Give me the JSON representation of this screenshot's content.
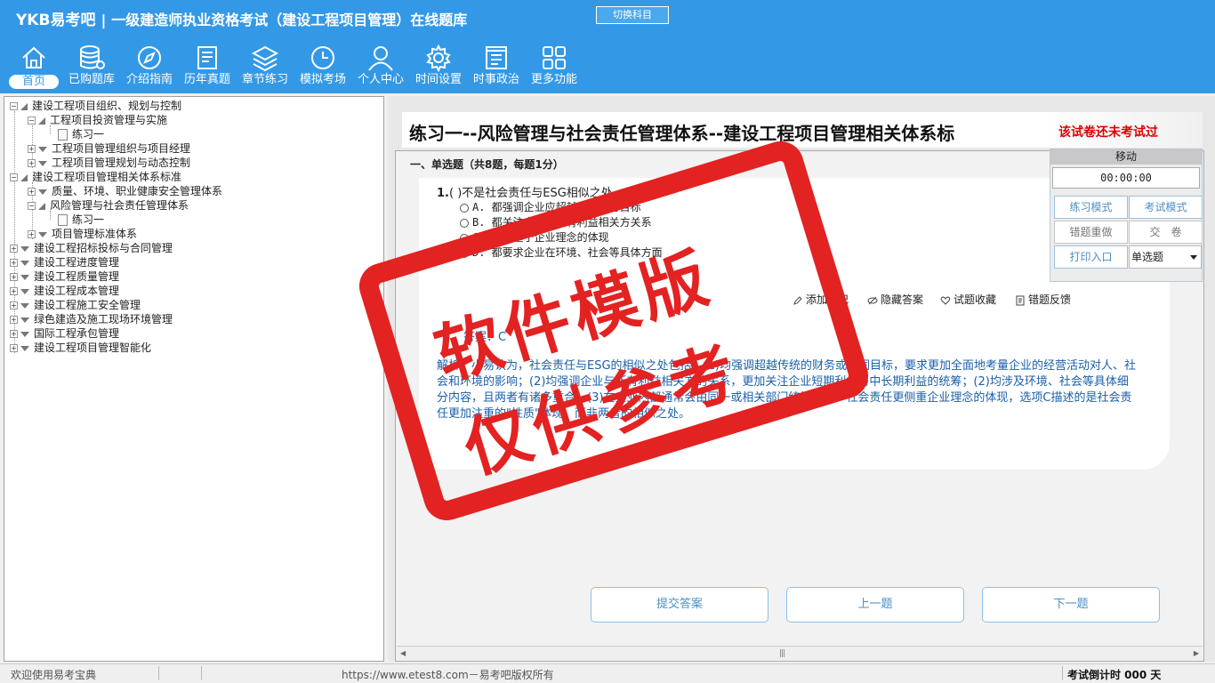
{
  "header": {
    "brand": "YKB易考吧",
    "title": "一级建造师执业资格考试（建设工程项目管理）在线题库",
    "switch_label": "切换科目",
    "nav": [
      {
        "label": "首页",
        "icon": "home-icon"
      },
      {
        "label": "已购题库",
        "icon": "database-icon"
      },
      {
        "label": "介绍指南",
        "icon": "compass-icon"
      },
      {
        "label": "历年真题",
        "icon": "document-list-icon"
      },
      {
        "label": "章节练习",
        "icon": "layers-icon"
      },
      {
        "label": "模拟考场",
        "icon": "clock-icon"
      },
      {
        "label": "个人中心",
        "icon": "user-icon"
      },
      {
        "label": "时间设置",
        "icon": "gear-icon"
      },
      {
        "label": "时事政治",
        "icon": "news-icon"
      },
      {
        "label": "更多功能",
        "icon": "grid-icon"
      }
    ]
  },
  "tree": [
    {
      "label": "建设工程项目组织、规划与控制"
    },
    {
      "label": "工程项目投资管理与实施"
    },
    {
      "label": "练习一"
    },
    {
      "label": "工程项目管理组织与项目经理"
    },
    {
      "label": "工程项目管理规划与动态控制"
    },
    {
      "label": "建设工程项目管理相关体系标准"
    },
    {
      "label": "质量、环境、职业健康安全管理体系"
    },
    {
      "label": "风险管理与社会责任管理体系"
    },
    {
      "label": "练习一"
    },
    {
      "label": "项目管理标准体系"
    },
    {
      "label": "建设工程招标投标与合同管理"
    },
    {
      "label": "建设工程进度管理"
    },
    {
      "label": "建设工程质量管理"
    },
    {
      "label": "建设工程成本管理"
    },
    {
      "label": "建设工程施工安全管理"
    },
    {
      "label": "绿色建造及施工现场环境管理"
    },
    {
      "label": "国际工程承包管理"
    },
    {
      "label": "建设工程项目管理智能化"
    }
  ],
  "main": {
    "exercise_title": "练习一--风险管理与社会责任管理体系--建设工程项目管理相关体系标",
    "exam_status": "该试卷还未考试过",
    "section_header": "一、单选题（共8题，每题1分）",
    "question": {
      "number": "1.",
      "stem": "( )不是社会责任与ESG相似之处。",
      "options": [
        "A. 都强调企业应超越传统财务目标",
        "B. 都关注企业与所有利益相关方关系",
        "C. 都侧重于企业理念的体现",
        "D. 都要求企业在环境、社会等具体方面"
      ]
    },
    "tools": {
      "add_note": "添加笔记",
      "hide_answer": "隐藏答案",
      "favorite": "试题收藏",
      "report_error": "错题反馈"
    },
    "answer_line": "答案：C",
    "analysis": "解析：小易认为，社会责任与ESG的相似之处包括：(1)均强调超越传统的财务或利润目标，要求更加全面地考量企业的经营活动对人、社会和环境的影响；(2)均强调企业与所有利益相关方的关系，更加关注企业短期利益与中长期利益的统筹；(2)均涉及环境、社会等具体细分内容，且两者有诸多重合。(3)在企业内部通常会由同一或相关部门统筹落实。社会责任更侧重企业理念的体现，选项C描述的是社会责任更加注重的\"性质\"体现，而非两者的相似之处。",
    "buttons": {
      "submit": "提交答案",
      "prev": "上一题",
      "next": "下一题"
    }
  },
  "control_panel": {
    "move_label": "移动",
    "timer": "00:00:00",
    "practice_mode": "练习模式",
    "exam_mode": "考试模式",
    "redo_wrong": "错题重做",
    "submit_paper": "交　卷",
    "print": "打印入口",
    "question_type": "单选题"
  },
  "status_bar": {
    "welcome": "欢迎使用易考宝典",
    "copyright": "https://www.etest8.com－易考吧版权所有",
    "countdown": "考试倒计时 000 天"
  },
  "watermark": {
    "line1": "软件模版",
    "line2": "仅供参考"
  },
  "colors": {
    "header_bg": "#3399e6",
    "accent_text": "#1b5fa8",
    "watermark": "#e32222",
    "status_red": "#dd0000"
  }
}
